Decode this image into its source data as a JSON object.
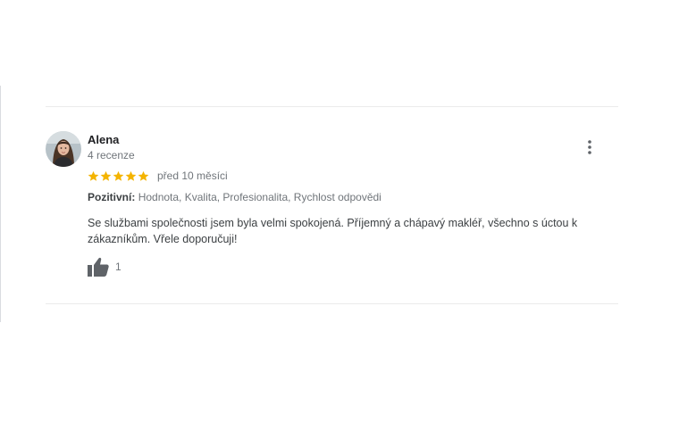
{
  "review": {
    "author": "Alena",
    "review_count": "4 recenze",
    "rating": 5,
    "max_rating": 5,
    "date": "před 10 měsíci",
    "attributes_label": "Pozitivní:",
    "attributes_value": "Hodnota, Kvalita, Profesionalita, Rychlost odpovědi",
    "text": "Se službami společnosti jsem byla velmi spokojená. Příjemný a chápavý makléř, všechno s úctou k zákazníkům. Vřele doporučuji!",
    "like_count": "1"
  },
  "colors": {
    "star": "#f4b400",
    "secondary_text": "#70757a",
    "icon": "#5f6368"
  }
}
